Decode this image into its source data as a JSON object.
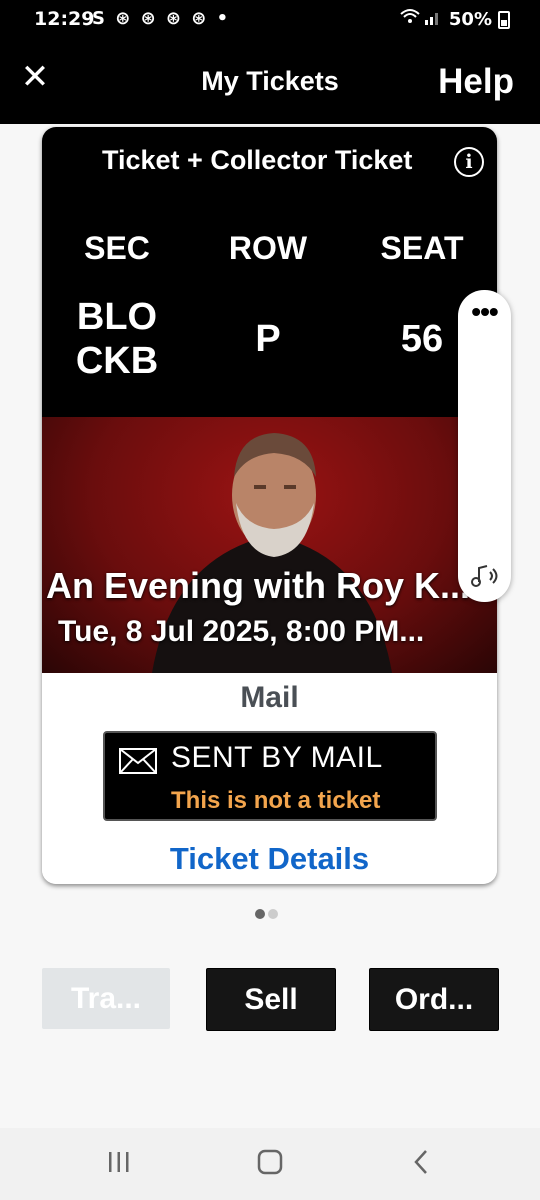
{
  "status_bar": {
    "time": "12:29",
    "notification_icons": "S ⊛ ⊛ ⊛ ⊛ •",
    "battery": "50%",
    "signal_icon": "wifi-signal-icons"
  },
  "app_bar": {
    "title": "My Tickets",
    "help_label": "Help",
    "close_icon": "close-icon"
  },
  "ticket": {
    "type_label": "Ticket + Collector Ticket",
    "section_header": "SEC",
    "section_value": "BLO CKB",
    "row_header": "ROW",
    "row_value": "P",
    "seat_header": "SEAT",
    "seat_value": "56",
    "event_name": "An Evening with Roy K...",
    "event_date": "Tue, 8 Jul 2025, 8:00 PM...",
    "delivery_label": "Mail",
    "sent_title": "SENT BY MAIL",
    "sent_note": "This is not a ticket",
    "details_link": "Ticket Details"
  },
  "side_panel": {
    "more_label": "•••",
    "audio_icon": "audio-icon"
  },
  "pager": {
    "total": 2,
    "current": 1
  },
  "actions": {
    "transfer_label": "Tra...",
    "sell_label": "Sell",
    "order_label": "Ord..."
  },
  "colors": {
    "accent_link": "#1166c9",
    "warning_text": "#f3a54d",
    "event_bg": "#7a1010",
    "disabled_button": "#e2e5e7"
  }
}
